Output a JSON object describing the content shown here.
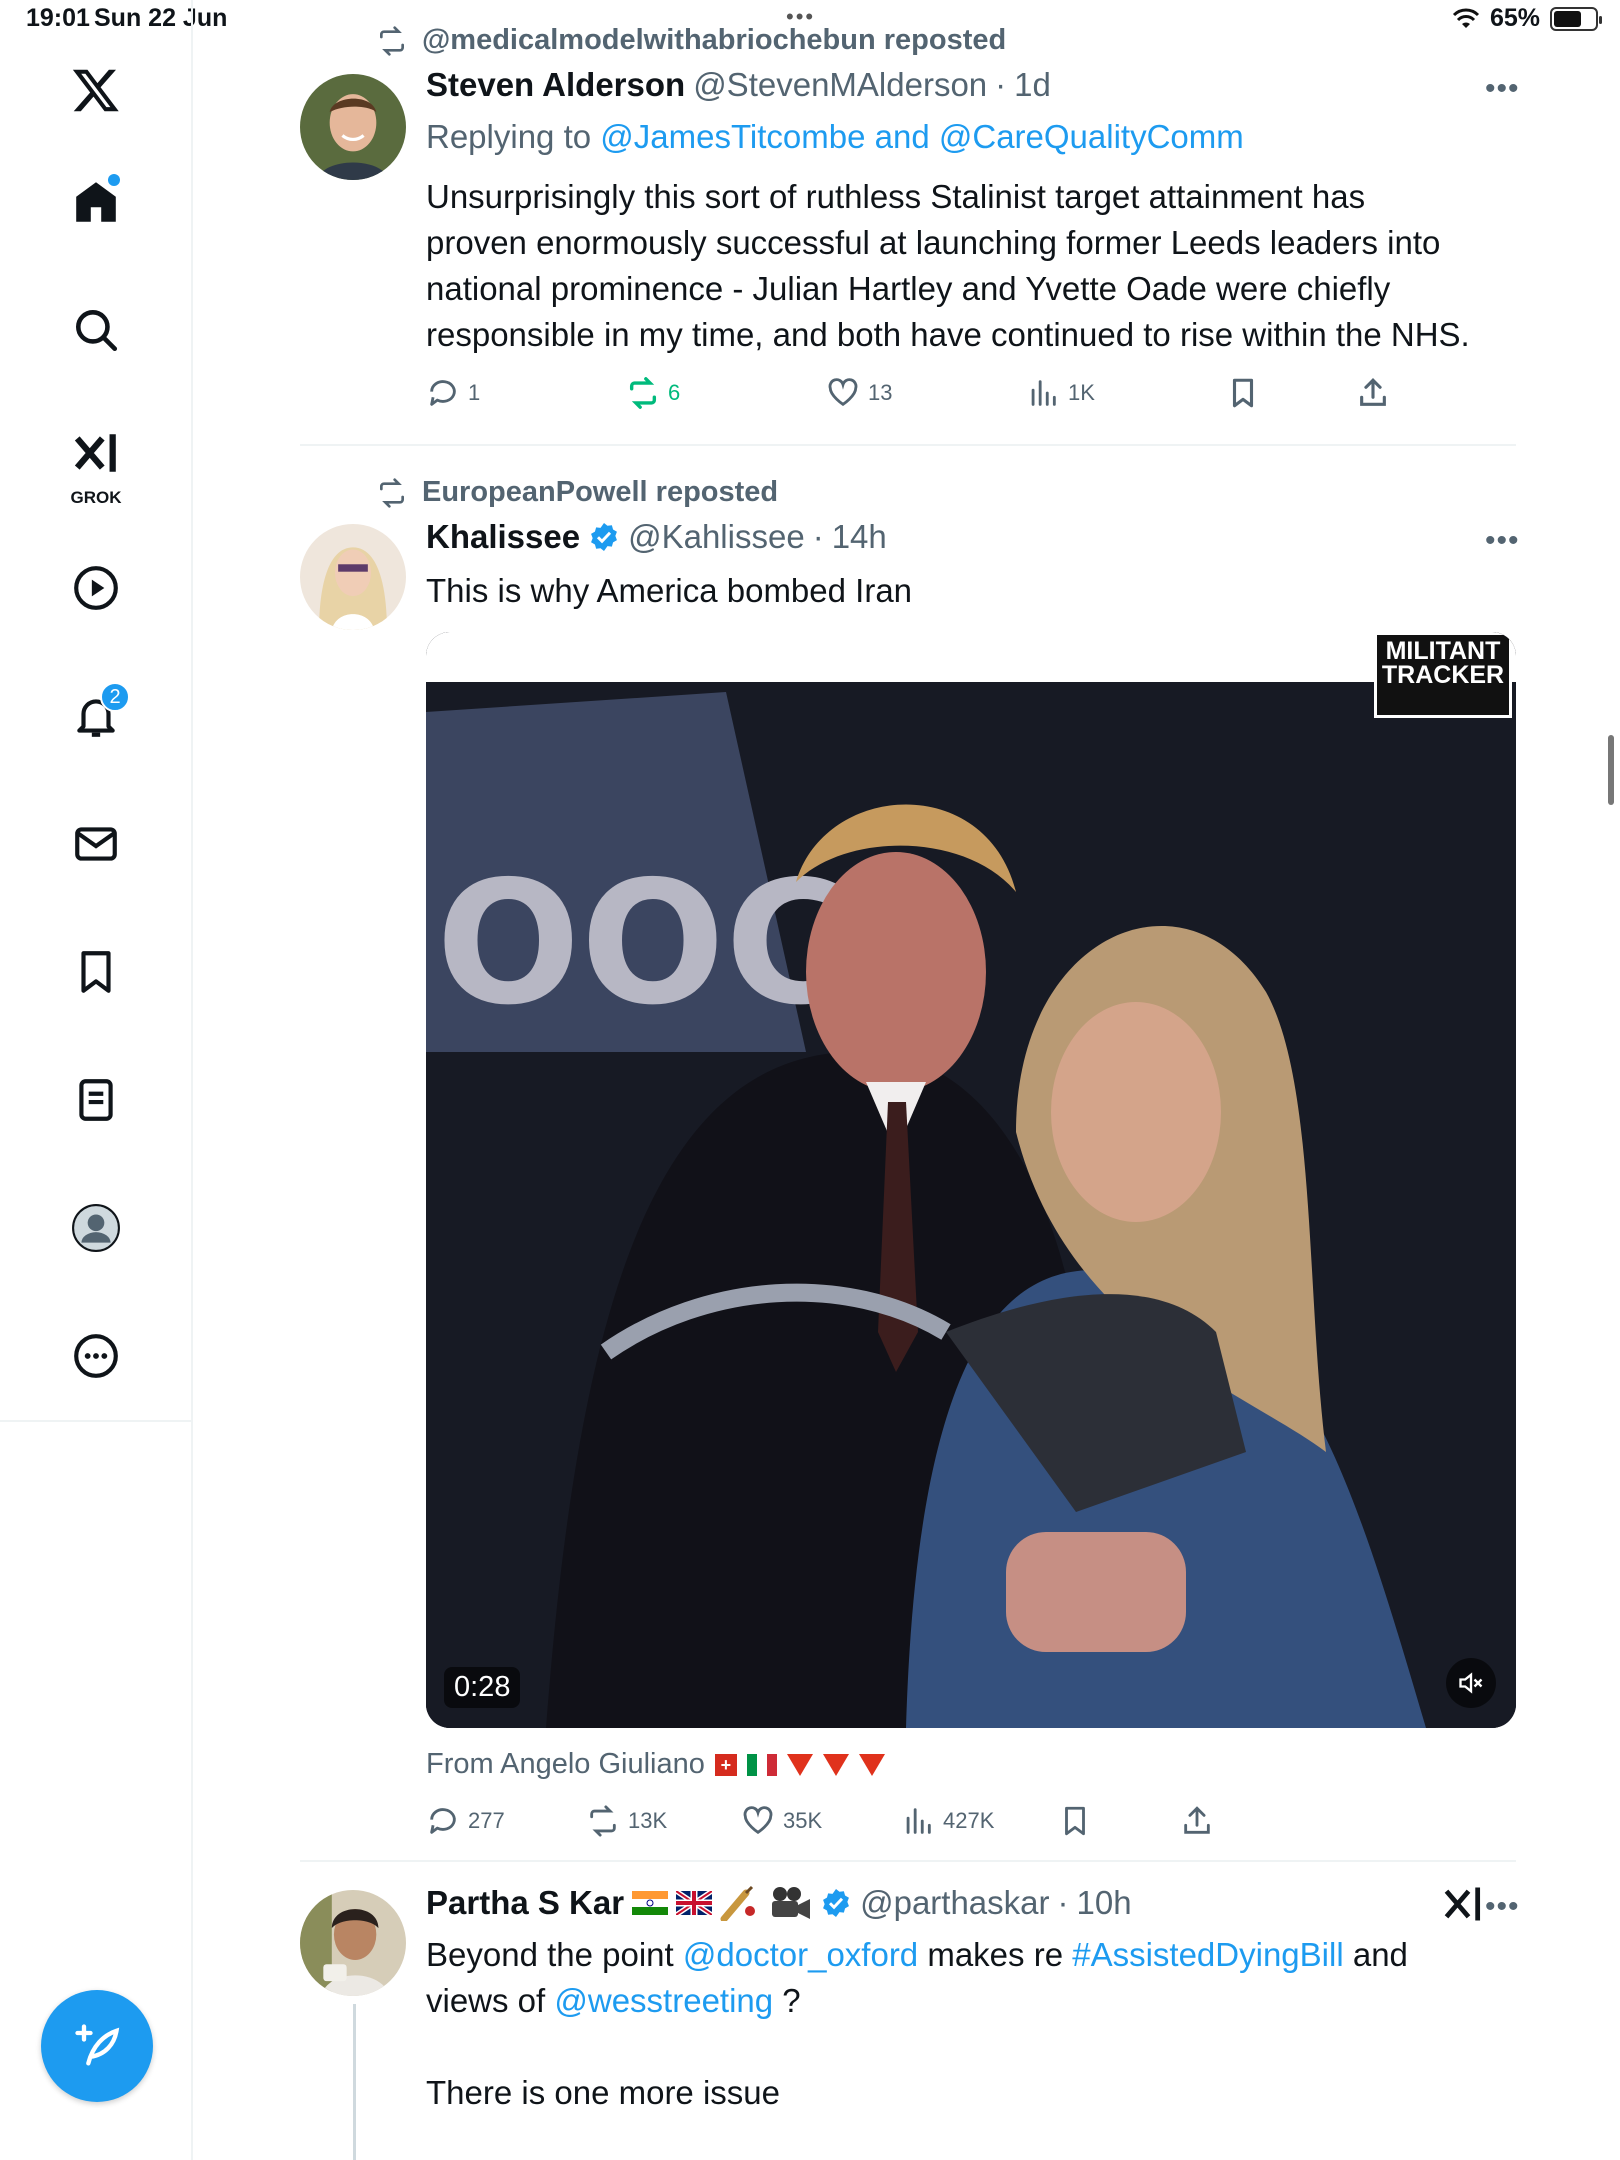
{
  "status": {
    "time": "19:01",
    "date": "Sun 22 Jun",
    "battery": "65%",
    "battery_level": 0.65
  },
  "sidebar": {
    "items": [
      {
        "name": "home",
        "icon": "home-icon",
        "has_dot": true
      },
      {
        "name": "explore",
        "icon": "search-icon"
      },
      {
        "name": "grok",
        "icon": "grok-icon",
        "label": "GROK"
      },
      {
        "name": "videos",
        "icon": "play-icon"
      },
      {
        "name": "notifications",
        "icon": "bell-icon",
        "badge": "2"
      },
      {
        "name": "messages",
        "icon": "mail-icon"
      },
      {
        "name": "bookmarks",
        "icon": "bookmark-icon"
      },
      {
        "name": "lists",
        "icon": "list-icon"
      },
      {
        "name": "profile",
        "icon": "avatar-icon"
      },
      {
        "name": "more",
        "icon": "more-circle-icon"
      }
    ],
    "compose_icon": "feather-plus-icon",
    "accent": "#1d9bf0"
  },
  "posts": [
    {
      "repost_label": "@medicalmodelwithabriochebun reposted",
      "name": "Steven Alderson",
      "handle": "@StevenMAlderson",
      "sep": "·",
      "time": "1d",
      "reply_prefix": "Replying to ",
      "reply_user1": "@JamesTitcombe",
      "reply_and": " and ",
      "reply_user2": "@CareQualityComm",
      "text_lines": [
        "Unsurprisingly this sort of ruthless Stalinist target attainment has",
        "proven enormously successful at launching former Leeds leaders into",
        "national prominence - Julian Hartley and Yvette Oade were chiefly",
        "responsible in my time, and both have continued to rise within the NHS."
      ],
      "replies": "1",
      "reposts": "6",
      "likes": "13",
      "views": "1K",
      "repost_color": "#00ba7c"
    },
    {
      "repost_label": "EuropeanPowell reposted",
      "name": "Khalissee",
      "handle": "@Kahlissee",
      "sep": "·",
      "time": "14h",
      "text": "This is why America bombed Iran",
      "media_duration": "0:28",
      "media_watermark_line1": "MILITANT",
      "media_watermark_line2": "TRACKER",
      "from_label": "From Angelo Giuliano",
      "replies": "277",
      "reposts": "13K",
      "likes": "35K",
      "views": "427K"
    },
    {
      "name": "Partha S Kar",
      "handle": "@parthaskar",
      "sep": "·",
      "time": "10h",
      "text_part1": "Beyond the point ",
      "mention1": "@doctor_oxford",
      "text_part2": " makes re ",
      "hashtag": "#AssistedDyingBill",
      "text_part3": " and",
      "text_line2_part1": "views of ",
      "mention2": "@wesstreeting",
      "text_line2_part2": " ?",
      "text_line3": "There is one more issue"
    }
  ]
}
